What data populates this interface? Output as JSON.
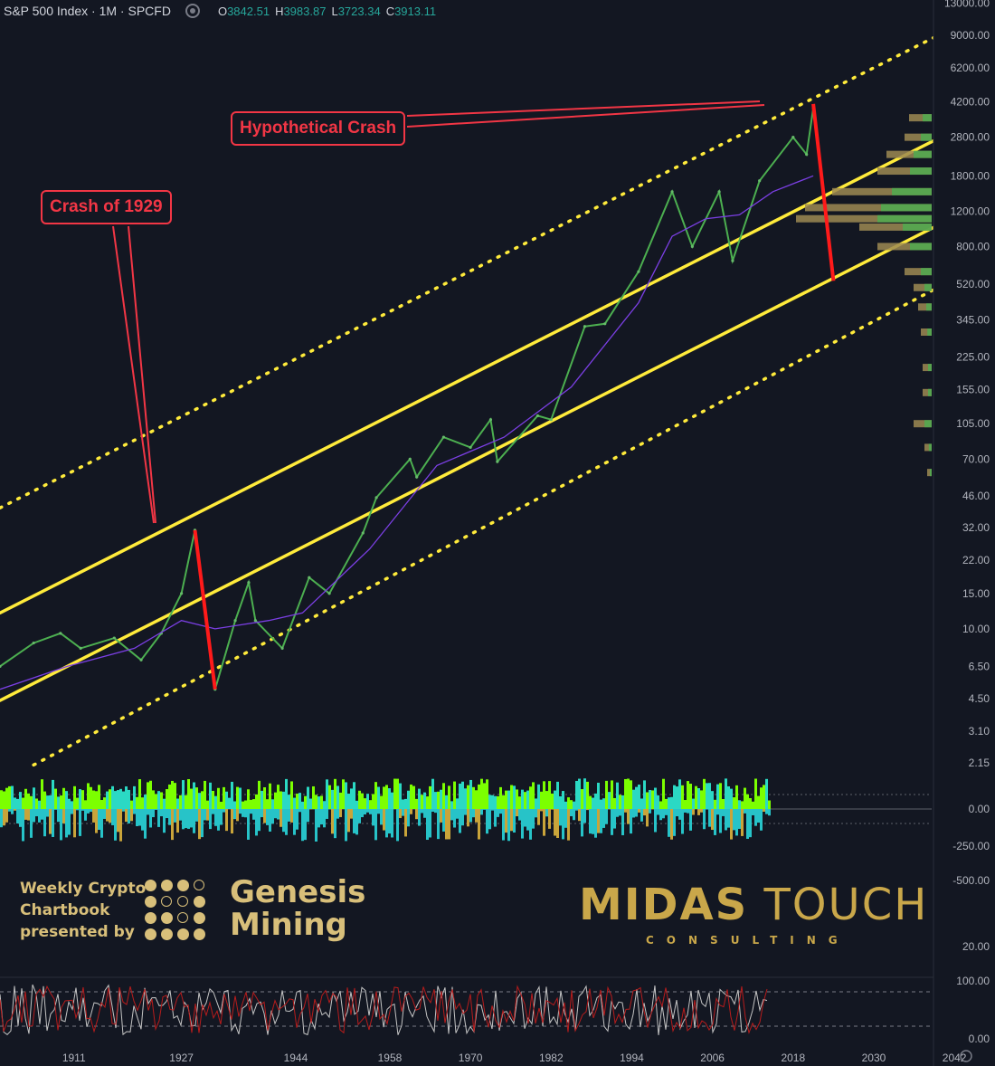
{
  "header": {
    "symbol": "S&P 500 Index · 1M · SPCFD",
    "open_label": "O",
    "open": "3842.51",
    "high_label": "H",
    "high": "3983.87",
    "low_label": "L",
    "low": "3723.34",
    "close_label": "C",
    "close": "3913.11"
  },
  "annotations": {
    "crash_1929": "Crash of 1929",
    "hypothetical": "Hypothetical Crash"
  },
  "branding": {
    "left_line1": "Weekly Crypto",
    "left_line2": "Chartbook",
    "left_line3": "presented by",
    "genesis_line1": "Genesis",
    "genesis_line2": "Mining",
    "midas_bold": "MIDAS",
    "midas_light": "TOUCH",
    "consulting": "CONSULTING"
  },
  "chart_data": {
    "type": "line",
    "title": "S&P 500 Index · 1M · SPCFD",
    "scale": "log",
    "xlim": [
      1900,
      2044
    ],
    "ylim": [
      1.9,
      13500
    ],
    "x_ticks": [
      "1911",
      "1927",
      "1944",
      "1958",
      "1970",
      "1982",
      "1994",
      "2006",
      "2018",
      "2030",
      "2042"
    ],
    "y_ticks": [
      "13000.00",
      "9000.00",
      "6200.00",
      "4200.00",
      "2800.00",
      "1800.00",
      "1200.00",
      "800.00",
      "520.00",
      "345.00",
      "225.00",
      "155.00",
      "105.00",
      "70.00",
      "46.00",
      "32.00",
      "22.00",
      "15.00",
      "10.00",
      "6.50",
      "4.50",
      "3.10",
      "2.15"
    ],
    "series": [
      {
        "name": "",
        "color": "#4caf50",
        "x": [
          1900,
          1905,
          1909,
          1912,
          1917,
          1921,
          1924,
          1927,
          1929,
          1932,
          1935,
          1937,
          1938,
          1942,
          1946,
          1949,
          1954,
          1956,
          1961,
          1962,
          1966,
          1970,
          1973,
          1974,
          1980,
          1982,
          1987,
          1990,
          1995,
          2000,
          2003,
          2007,
          2009,
          2013,
          2018,
          2020,
          2021
        ],
        "y": [
          6.5,
          8.5,
          9.5,
          8,
          9,
          7,
          9.5,
          15,
          31,
          5,
          11,
          17,
          11,
          8,
          18,
          15,
          30,
          45,
          70,
          57,
          90,
          80,
          110,
          68,
          115,
          110,
          320,
          330,
          600,
          1500,
          800,
          1500,
          680,
          1700,
          2800,
          2300,
          3913
        ]
      },
      {
        "name": "",
        "color": "#7b3fe4",
        "x": [
          1900,
          1910,
          1920,
          1927,
          1932,
          1940,
          1945,
          1955,
          1965,
          1975,
          1985,
          1995,
          2000,
          2005,
          2010,
          2015,
          2021
        ],
        "y": [
          5,
          6.5,
          8,
          11,
          10,
          11,
          12,
          25,
          65,
          90,
          160,
          420,
          900,
          1100,
          1150,
          1500,
          1800
        ]
      }
    ],
    "channel": {
      "solid_upper": {
        "from": [
          1900,
          12
        ],
        "to": [
          2039,
          2700
        ]
      },
      "solid_lower": {
        "from": [
          1900,
          4.4
        ],
        "to": [
          2039,
          1000
        ]
      },
      "dotted_upper": {
        "from": [
          1900,
          40
        ],
        "to": [
          2039,
          8800
        ]
      },
      "dotted_lower": {
        "from": [
          1905,
          2.1
        ],
        "to": [
          2044,
          600
        ]
      }
    },
    "crash_lines": [
      {
        "from": [
          1929,
          31
        ],
        "to": [
          1932,
          5
        ]
      },
      {
        "from": [
          2021,
          4100
        ],
        "to": [
          2024,
          540
        ]
      }
    ],
    "oscillator": {
      "y_ticks": [
        "0.00",
        "-250.00",
        "-500.00"
      ]
    },
    "stochastic": {
      "y_ticks": [
        "20.00",
        "100.00",
        "0.00"
      ]
    }
  }
}
